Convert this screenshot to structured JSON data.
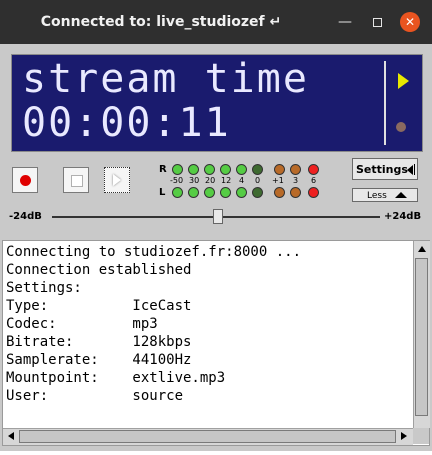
{
  "window": {
    "title": "Connected to: live_studiozef ↵",
    "controls": [
      "minimize-icon",
      "maximize-icon",
      "close-icon"
    ]
  },
  "display": {
    "line1": "stream time",
    "line2": "00:00:11",
    "play_indicator_color": "#e8e800",
    "record_indicator_color": "#8a6a60",
    "background": "#1a1b6e"
  },
  "transport": {
    "record_icon": "record-dot-icon",
    "stop_icon": "stop-square-icon",
    "play_icon": "play-triangle-icon"
  },
  "meter": {
    "channels": [
      "R",
      "L"
    ],
    "scale": [
      "-50",
      "30",
      "20",
      "12",
      "4",
      "0",
      "+1",
      "3",
      "6"
    ]
  },
  "settings": {
    "settings_label": "Settings",
    "less_label": "Less"
  },
  "slider": {
    "min_label": "-24dB",
    "max_label": "+24dB"
  },
  "log": {
    "lines": [
      "Connecting to studiozef.fr:8000 ...",
      "Connection established",
      "Settings:",
      "Type:          IceCast",
      "Codec:         mp3",
      "Bitrate:       128kbps",
      "Samplerate:    44100Hz",
      "Mountpoint:    extlive.mp3",
      "User:          source"
    ]
  }
}
